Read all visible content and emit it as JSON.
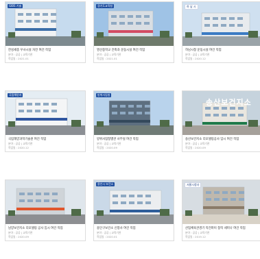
{
  "cards": [
    {
      "badge": "GIBS 기술",
      "title": "한성세종 우사시설 자전 여건 작업",
      "category": "분야 : 공공 | 교육기관",
      "date": "작업일 : 2021.01",
      "palette": {
        "sky": "#c6dbee",
        "building": "#f1f3f4",
        "accent": "#3b6ea8",
        "ground": "#7d8a8f"
      }
    },
    {
      "badge": "경기도교육청",
      "title": "영선중학교 전축과 운동시설 여건 작업",
      "category": "분야 : 공공 | 교육기관",
      "date": "작업일 : 2021.01",
      "palette": {
        "sky": "#9fc3e6",
        "building": "#d9dee3",
        "accent": "#d24b63",
        "ground": "#6e7a6b"
      }
    },
    {
      "badge": "하 남 시",
      "title": "하남시청 운동시설 여건 작업",
      "category": "분야 : 공공 | 교육기관",
      "date": "작업일 : 2020.12",
      "palette": {
        "sky": "#cfe0f0",
        "building": "#e8ebee",
        "accent": "#3b7bc4",
        "ground": "#9aa3a8"
      }
    },
    {
      "badge": "국립해양과",
      "title": "국립해양과학기술원 여건 작업",
      "category": "분야 : 공공 | 교육기관",
      "date": "작업일 : 2020.12",
      "palette": {
        "sky": "#e5edf3",
        "building": "#f4f5f6",
        "accent": "#3056a0",
        "ground": "#8b8f94"
      }
    },
    {
      "badge": "방위사업청",
      "title": "방위사업청별관 사무실 여건 작업",
      "category": "분야 : 공공 | 교육기관",
      "date": "작업일 : 2020.09",
      "palette": {
        "sky": "#b9d3ec",
        "building": "#5d6f80",
        "accent": "#34495c",
        "ground": "#6f7b76"
      }
    },
    {
      "badge": "",
      "sign": "송산보건지소",
      "title": "송산보건지소 리모델링공사 임시 여건 작업",
      "category": "분야 : 공공 | 교육기관",
      "date": "작업일 : 2020.09",
      "palette": {
        "sky": "#c6d3dd",
        "building": "#e9e6df",
        "accent": "#1f7a4a",
        "ground": "#a5a09a"
      }
    },
    {
      "badge": "",
      "title": "남양보건지소 리모델링 공사 임시 여건 작업",
      "category": "분야 : 공공 | 교육기관",
      "date": "작업일 : 2020.09",
      "palette": {
        "sky": "#dfe6ec",
        "building": "#cfd4d8",
        "accent": "#e0562c",
        "ground": "#8d8f92"
      }
    },
    {
      "badge": "용인시 보건소",
      "title": "용인구보건소 신청사 여건 작업",
      "category": "분야 : 공공 | 교육기관",
      "date": "작업일 : 2020.01",
      "palette": {
        "sky": "#cad9e8",
        "building": "#eceef0",
        "accent": "#2d5d9a",
        "ground": "#8f9498"
      }
    },
    {
      "badge": "서울시청사",
      "title": "산업체육관경기 작전파이 창작 세미나 여건 작업",
      "category": "분야 : 공공 | 교육기관",
      "date": "작업일 : 2019.12",
      "palette": {
        "sky": "#d7dde2",
        "building": "#bfb8ad",
        "accent": "#8a7b68",
        "ground": "#d8d2c7"
      }
    }
  ]
}
